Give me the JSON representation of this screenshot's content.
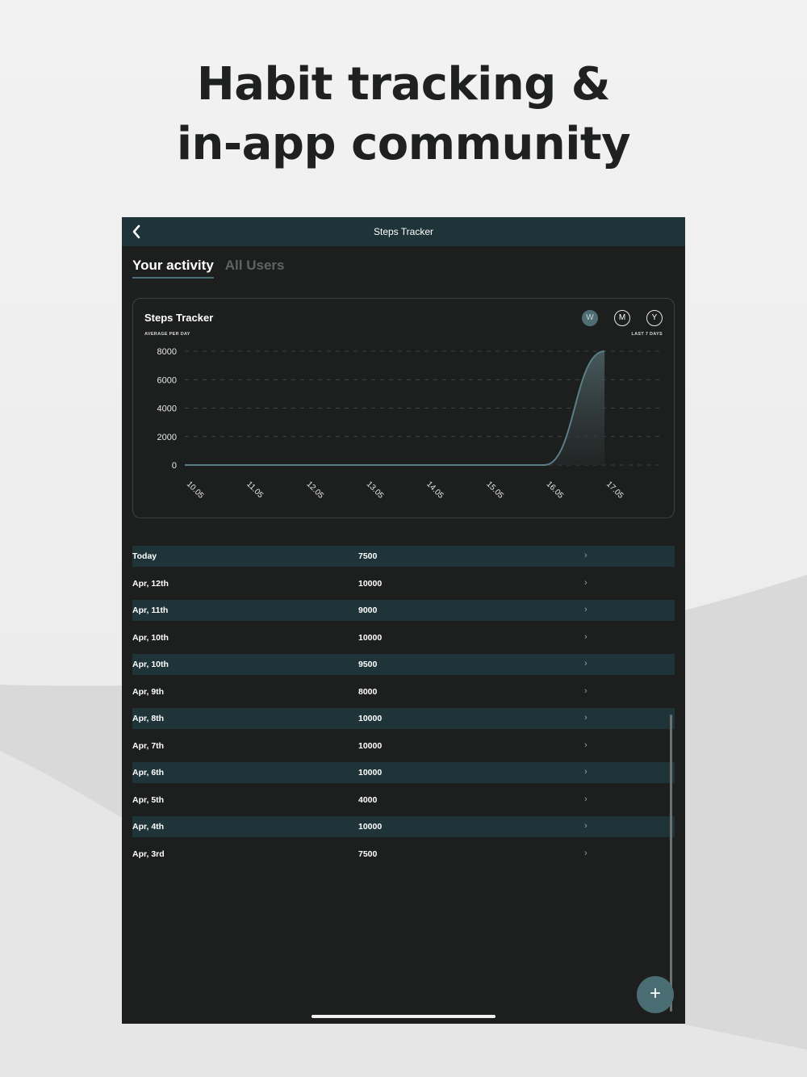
{
  "headline": {
    "line1": "Habit tracking &",
    "line2": "in-app community"
  },
  "nav": {
    "title": "Steps Tracker",
    "back_icon": "chevron-left-icon"
  },
  "tabs": [
    {
      "label": "Your activity",
      "active": true
    },
    {
      "label": "All Users",
      "active": false
    }
  ],
  "card": {
    "title": "Steps Tracker",
    "subtitle": "AVERAGE PER DAY",
    "periods": [
      "W",
      "M",
      "Y"
    ],
    "selected_period": "W",
    "range_label": "LAST 7 DAYS"
  },
  "chart_data": {
    "type": "area",
    "title": "Steps Tracker",
    "ylabel": "",
    "xlabel": "",
    "categories": [
      "10.05",
      "11.05",
      "12.05",
      "13.05",
      "14.05",
      "15.05",
      "16.05",
      "17.05"
    ],
    "values": [
      0,
      0,
      0,
      0,
      0,
      0,
      0,
      8000
    ],
    "y_ticks": [
      0,
      2000,
      4000,
      6000,
      8000
    ],
    "ylim": [
      0,
      8000
    ],
    "grid": true,
    "line_color": "#5a7f86"
  },
  "entries": [
    {
      "date": "Today",
      "value": "7500"
    },
    {
      "date": "Apr, 12th",
      "value": "10000"
    },
    {
      "date": "Apr, 11th",
      "value": "9000"
    },
    {
      "date": "Apr, 10th",
      "value": "10000"
    },
    {
      "date": "Apr, 10th",
      "value": "9500"
    },
    {
      "date": "Apr, 9th",
      "value": "8000"
    },
    {
      "date": "Apr, 8th",
      "value": "10000"
    },
    {
      "date": "Apr, 7th",
      "value": "10000"
    },
    {
      "date": "Apr, 6th",
      "value": "10000"
    },
    {
      "date": "Apr, 5th",
      "value": "4000"
    },
    {
      "date": "Apr, 4th",
      "value": "10000"
    },
    {
      "date": "Apr, 3rd",
      "value": "7500"
    }
  ],
  "fab": {
    "label": "+",
    "icon": "plus-icon"
  },
  "colors": {
    "accent": "#4a6d73",
    "nav_bg": "#1f3439",
    "screen_bg": "#1d1f1e",
    "stripe": "#1f3439"
  }
}
